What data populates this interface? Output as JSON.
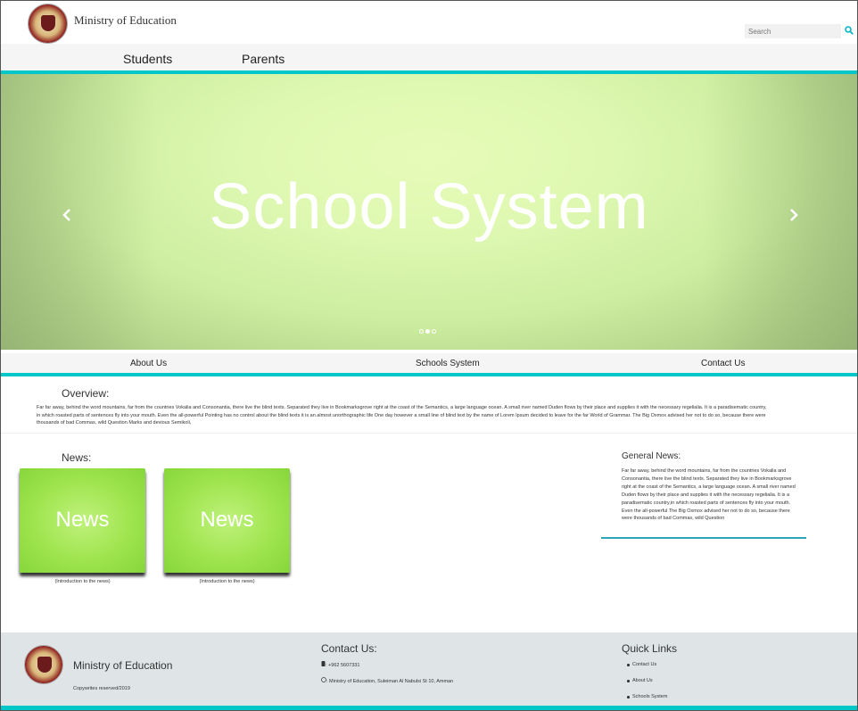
{
  "header": {
    "brand": "Ministry of Education",
    "search_placeholder": "Search"
  },
  "nav": {
    "students": "Students",
    "parents": "Parents"
  },
  "hero": {
    "title": "School System",
    "slides": 3,
    "active_slide": 2
  },
  "subnav": {
    "about": "About Us",
    "schools": "Schools System",
    "contact": "Contact Us"
  },
  "overview": {
    "title": "Overview:",
    "text": "Far far away, behind the word mountains, far from the countries Vokalia and Consonantia, there live the blind texts. Separated they live in Bookmarksgrove right at the coast of the Semantics, a large language ocean. A small river named Duden flows by their place and supplies it with the necessary regelialia. It is a paradisematic country, in which roasted parts of sentences fly into your mouth. Even the all-powerful Pointing has no control about the blind texts it is an almost unorthographic life One day however a small line of blind text by the name of Lorem Ipsum decided to leave for the far World of Grammar. The Big Oxmox advised her not to do so, because there were thousands of bad Commas, wild Question Marks and devious Semikoli,"
  },
  "news": {
    "title": "News:",
    "cards": [
      {
        "label": "News",
        "caption": "(Introduction to the news)"
      },
      {
        "label": "News",
        "caption": "(Introduction to the news)"
      }
    ]
  },
  "general_news": {
    "title": "General News:",
    "text": "Far far away, behind the word mountains, far from the countries Vokalia and Consonantia, there live the blind texts. Separated they live in Bookmarksgrove right at the coast of the Semantics, a large language ocean. A small river named Duden flows by their place and supplies it with the necessary regelialia. It is a paradisematic country,in which roasted parts of sentences fly into your mouth. Even the all-powerful The Big Oxmox advised her not to do so, because there were thousands of bad Commas, wild Question"
  },
  "footer": {
    "brand": "Ministry of Education",
    "copyright": "Copywrites reserved/2019",
    "contact_title": "Contact Us:",
    "phone": ": +962 5607331",
    "address": ": Ministry of Education, Suleiman Al Nabulsi St 10, Amman",
    "quick_links_title": "Quick Links",
    "quick_links": [
      "Contact Us",
      "About Us",
      "Schools System"
    ]
  },
  "colors": {
    "accent": "#00c8c8",
    "news_green": "#9fe44e",
    "footer_bg": "#dfe5e7"
  }
}
